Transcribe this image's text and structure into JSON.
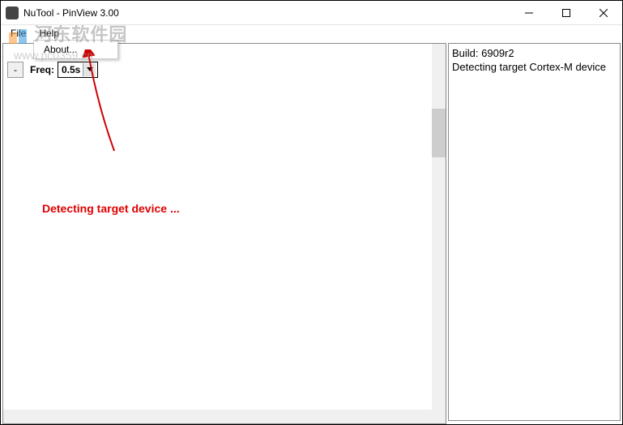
{
  "window": {
    "title": "NuTool - PinView 3.00"
  },
  "menu": {
    "file": "File",
    "help": "Help",
    "help_dropdown": {
      "about": "About..."
    }
  },
  "toolbar": {
    "minus": "-",
    "freq_label": "Freq:",
    "freq_value": "0.5s"
  },
  "main": {
    "detecting": "Detecting target device ..."
  },
  "log": {
    "build": "Build: 6909r2",
    "line2": "Detecting target Cortex-M device"
  },
  "watermark": {
    "text1": "河东软件园",
    "text2": "www.pc0359.cn"
  }
}
